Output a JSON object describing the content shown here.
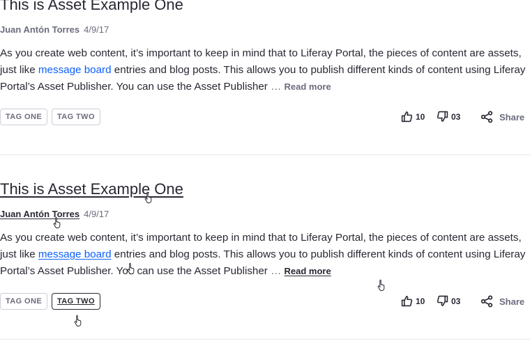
{
  "entries": [
    {
      "title": "This is Asset Example One",
      "author": "Juan Antón Torres",
      "date": "4/9/17",
      "body_before": "As you create web content, it’s important to keep in mind that to Liferay Portal, the pieces of content are assets, just like ",
      "body_link": "message board",
      "body_after": " entries and blog posts. This allows you to publish different kinds of content using Liferay Portal’s Asset Publisher. You can use the Asset Publisher ",
      "ellipsis": "…",
      "read_more": "Read more",
      "tags": [
        "TAG ONE",
        "TAG TWO"
      ],
      "likes": "10",
      "dislikes": "03",
      "share_label": "Share"
    },
    {
      "title": "This is Asset Example One",
      "author": "Juan Antón Torres",
      "date": "4/9/17",
      "body_before": "As you create web content, it’s important to keep in mind that to Liferay Portal, the pieces of content are assets, just like ",
      "body_link": "message board",
      "body_after": " entries and blog posts. This allows you to publish different kinds of content using Liferay Portal’s Asset Publisher. You can use the Asset Publisher ",
      "ellipsis": "…",
      "read_more": "Read more",
      "tags": [
        "TAG ONE",
        "TAG TWO"
      ],
      "likes": "10",
      "dislikes": "03",
      "share_label": "Share"
    }
  ],
  "icons": {
    "like": "thumbs-up-icon",
    "dislike": "thumbs-down-icon",
    "share": "share-icon",
    "cursor": "hand-pointer-cursor"
  },
  "colors": {
    "text": "#272833",
    "secondary": "#6b6c7e",
    "link": "#0b5fff",
    "border": "#cdced9",
    "divider": "#e7e7ed"
  }
}
